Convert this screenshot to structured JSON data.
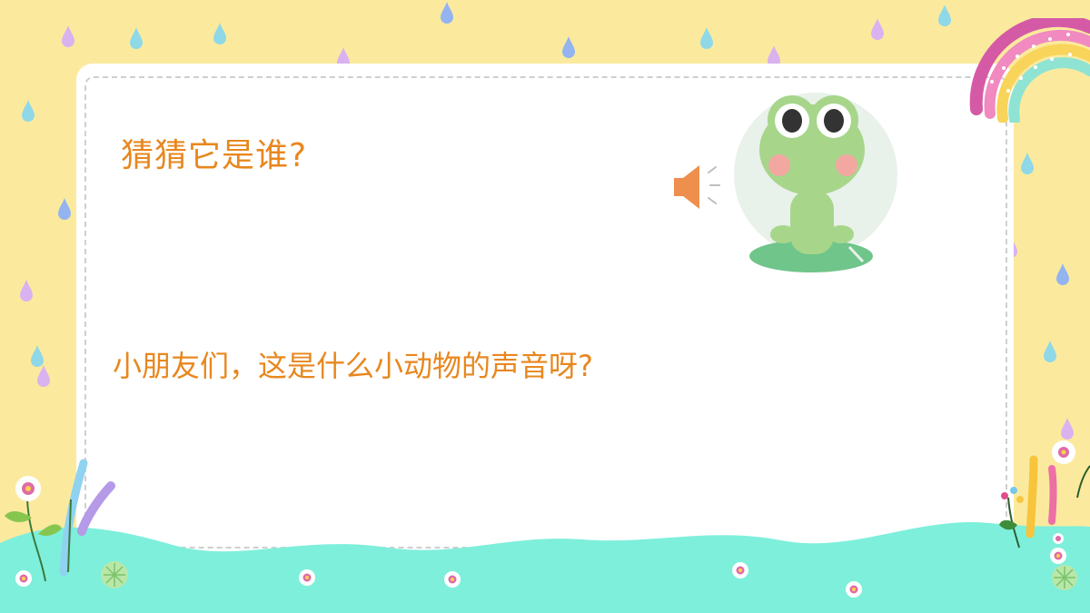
{
  "slide": {
    "title": "猜猜它是谁?",
    "question": "小朋友们，这是什么小动物的声音呀?"
  },
  "colors": {
    "background": "#FBEA9E",
    "card": "#FFFFFF",
    "text": "#E8871E",
    "ground": "#7EEFDB",
    "frog": "#A7D68B",
    "speaker": "#EF8F4E"
  },
  "icons": {
    "speaker": "speaker-icon",
    "frog": "frog-illustration",
    "rainbow": "rainbow-illustration"
  }
}
